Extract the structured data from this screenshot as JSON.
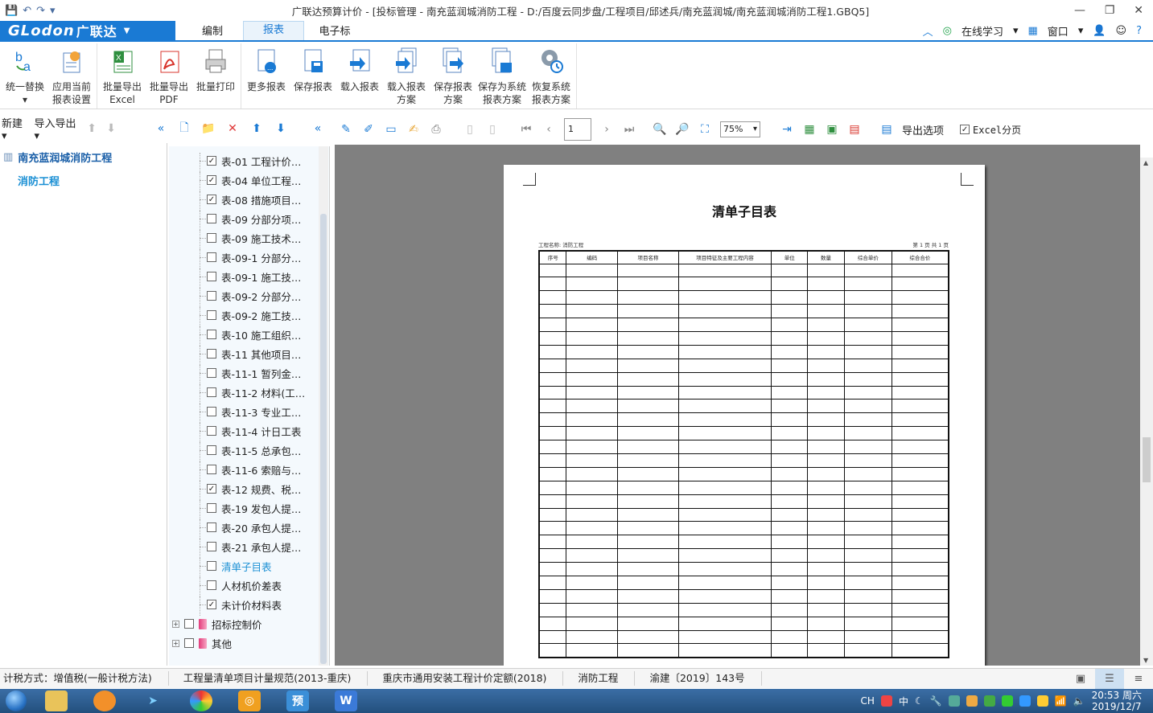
{
  "window": {
    "title": "广联达预算计价 - [投标管理 - 南充蓝润城消防工程 - D:/百度云同步盘/工程项目/邱述兵/南充蓝润城/南充蓝润城消防工程1.GBQ5]"
  },
  "menubar": {
    "logo_latin": "GLodon",
    "logo_zh": "广联达",
    "tabs": [
      {
        "label": "编制",
        "active": false
      },
      {
        "label": "报表",
        "active": true
      },
      {
        "label": "电子标",
        "active": false
      }
    ],
    "right": {
      "online": "在线学习",
      "window": "窗口"
    }
  },
  "ribbon": {
    "groups": [
      [
        {
          "label1": "统一替换",
          "label2": "▾",
          "icon": "replace-icon"
        },
        {
          "label1": "应用当前",
          "label2": "报表设置",
          "icon": "apply-settings-icon"
        }
      ],
      [
        {
          "label1": "批量导出",
          "label2": "Excel",
          "icon": "excel-export-icon"
        },
        {
          "label1": "批量导出",
          "label2": "PDF",
          "icon": "pdf-export-icon"
        },
        {
          "label1": "批量打印",
          "label2": "",
          "icon": "print-icon"
        }
      ],
      [
        {
          "label1": "更多报表",
          "label2": "",
          "icon": "more-reports-icon"
        },
        {
          "label1": "保存报表",
          "label2": "",
          "icon": "save-report-icon"
        },
        {
          "label1": "载入报表",
          "label2": "",
          "icon": "load-report-icon"
        },
        {
          "label1": "载入报表",
          "label2": "方案",
          "icon": "load-scheme-icon"
        },
        {
          "label1": "保存报表",
          "label2": "方案",
          "icon": "save-scheme-icon"
        },
        {
          "label1": "保存为系统",
          "label2": "报表方案",
          "icon": "save-system-scheme-icon"
        },
        {
          "label1": "恢复系统",
          "label2": "报表方案",
          "icon": "restore-system-icon"
        }
      ]
    ]
  },
  "left_toolbar": {
    "new": "新建",
    "import_export": "导入导出"
  },
  "preview_toolbar": {
    "page": "1",
    "zoom": "75%",
    "export_options": "导出选项",
    "excel_paging": "Excel分页"
  },
  "project_tree": {
    "root": "南充蓝润城消防工程",
    "child": "消防工程"
  },
  "report_tree": {
    "items": [
      {
        "label": "表-01 工程计价…",
        "checked": true
      },
      {
        "label": "表-04 单位工程…",
        "checked": true
      },
      {
        "label": "表-08 措施项目…",
        "checked": true
      },
      {
        "label": "表-09 分部分项…",
        "checked": false
      },
      {
        "label": "表-09 施工技术…",
        "checked": false
      },
      {
        "label": "表-09-1 分部分…",
        "checked": false
      },
      {
        "label": "表-09-1 施工技…",
        "checked": false
      },
      {
        "label": "表-09-2 分部分…",
        "checked": false
      },
      {
        "label": "表-09-2 施工技…",
        "checked": false
      },
      {
        "label": "表-10 施工组织…",
        "checked": false
      },
      {
        "label": "表-11 其他项目…",
        "checked": false
      },
      {
        "label": "表-11-1 暂列金…",
        "checked": false
      },
      {
        "label": "表-11-2 材料(工…",
        "checked": false
      },
      {
        "label": "表-11-3 专业工…",
        "checked": false
      },
      {
        "label": "表-11-4 计日工表",
        "checked": false
      },
      {
        "label": "表-11-5 总承包…",
        "checked": false
      },
      {
        "label": "表-11-6 索赔与…",
        "checked": false
      },
      {
        "label": "表-12 规费、税…",
        "checked": true
      },
      {
        "label": "表-19 发包人提…",
        "checked": false
      },
      {
        "label": "表-20 承包人提…",
        "checked": false
      },
      {
        "label": "表-21 承包人提…",
        "checked": false
      },
      {
        "label": "清单子目表",
        "checked": false,
        "selected": true
      },
      {
        "label": "人材机价差表",
        "checked": false
      },
      {
        "label": "未计价材料表",
        "checked": true
      }
    ],
    "groups": [
      {
        "label": "招标控制价"
      },
      {
        "label": "其他"
      }
    ]
  },
  "report_page": {
    "title": "清单子目表",
    "project_label": "工程名称: 消防工程",
    "page_info": "第 1 页 共 1 页",
    "columns": [
      "序号",
      "编码",
      "项目名称",
      "项目特征及主要工程内容",
      "单位",
      "数量",
      "综合单价",
      "综合合价"
    ],
    "empty_rows": 29
  },
  "statusbar": {
    "segments": [
      "计税方式：增值税(一般计税方法)",
      "工程量清单项目计量规范(2013-重庆)",
      "重庆市通用安装工程计价定额(2018)",
      "消防工程",
      "渝建〔2019〕143号"
    ]
  },
  "taskbar": {
    "tray_lang": "CH",
    "ime": "中",
    "time": "20:53 周六",
    "date": "2019/12/7"
  },
  "colors": {
    "accent": "#1a7ad4",
    "tree_bg": "#f4f9fd",
    "preview_bg": "#808080"
  }
}
